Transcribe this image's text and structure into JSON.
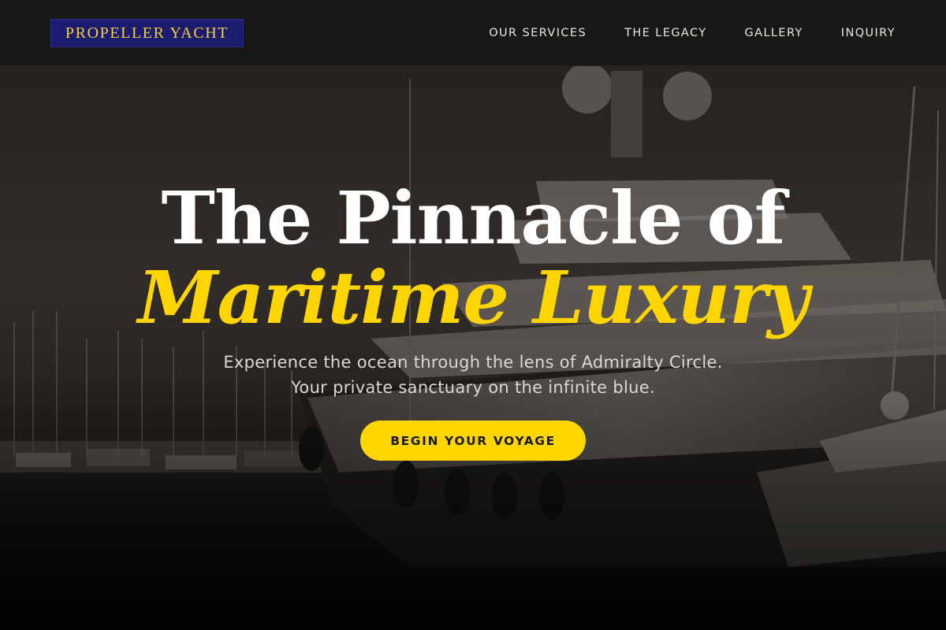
{
  "header": {
    "logo_text": "PROPELLER YACHT",
    "nav": [
      {
        "label": "OUR SERVICES"
      },
      {
        "label": "THE LEGACY"
      },
      {
        "label": "GALLERY"
      },
      {
        "label": "INQUIRY"
      }
    ]
  },
  "hero": {
    "headline_line1": "The Pinnacle of",
    "headline_line2": "Maritime Luxury",
    "tagline": "Experience the ocean through the lens of Admiralty Circle. Your private sanctuary on the infinite blue.",
    "cta_label": "BEGIN YOUR VOYAGE",
    "background_image": "yacht-at-marina-dusk-photo"
  },
  "colors": {
    "accent": "#ffd600",
    "logo_bg": "#1b1c6e",
    "header_bg": "#181716"
  }
}
